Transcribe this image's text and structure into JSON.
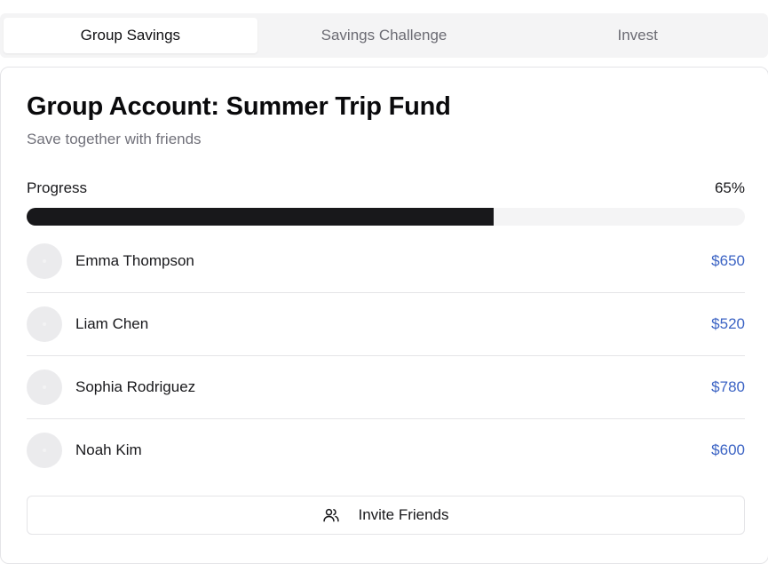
{
  "tabs": [
    {
      "label": "Group Savings",
      "active": true
    },
    {
      "label": "Savings Challenge",
      "active": false
    },
    {
      "label": "Invest",
      "active": false
    }
  ],
  "account": {
    "title": "Group Account: Summer Trip Fund",
    "subtitle": "Save together with friends"
  },
  "progress": {
    "label": "Progress",
    "percent_label": "65%",
    "value": 0.65
  },
  "members": [
    {
      "name": "Emma Thompson",
      "amount": "$650"
    },
    {
      "name": "Liam Chen",
      "amount": "$520"
    },
    {
      "name": "Sophia Rodriguez",
      "amount": "$780"
    },
    {
      "name": "Noah Kim",
      "amount": "$600"
    }
  ],
  "invite": {
    "label": "Invite Friends",
    "icon": "users-icon"
  },
  "colors": {
    "accent_amount": "#3b63c4",
    "progress_fill": "#18181b",
    "progress_track": "#f4f4f5"
  }
}
